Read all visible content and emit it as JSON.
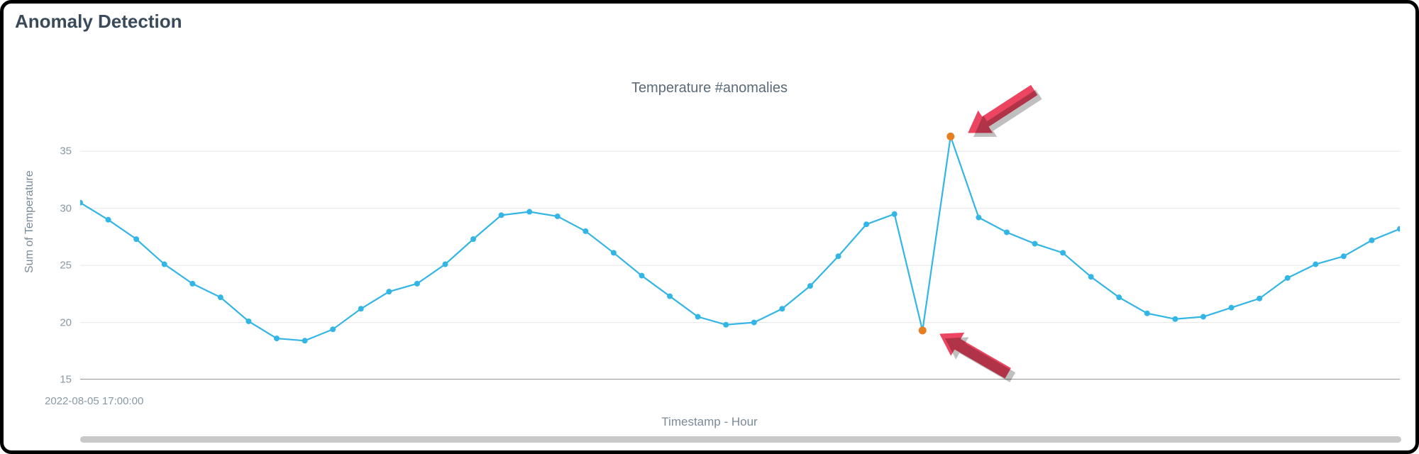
{
  "panel": {
    "title": "Anomaly Detection"
  },
  "chart_data": {
    "type": "line",
    "title": "Temperature #anomalies",
    "xlabel": "Timestamp - Hour",
    "ylabel": "Sum of Temperature",
    "x_first_tick": "2022-08-05 17:00:00",
    "ylim": [
      15,
      38
    ],
    "yticks": [
      15,
      20,
      25,
      30,
      35
    ],
    "grid": true,
    "series": [
      {
        "name": "Temperature",
        "color": "#33b5e5",
        "values": [
          30.5,
          29.0,
          27.3,
          25.1,
          23.4,
          22.2,
          20.1,
          18.6,
          18.4,
          19.4,
          21.2,
          22.7,
          23.4,
          25.1,
          27.3,
          29.4,
          29.7,
          29.3,
          28.0,
          26.1,
          24.1,
          22.3,
          20.5,
          19.8,
          20.0,
          21.2,
          23.2,
          25.8,
          28.6,
          29.5,
          19.3,
          36.3,
          29.2,
          27.9,
          26.9,
          26.1,
          24.0,
          22.2,
          20.8,
          20.3,
          20.5,
          21.3,
          22.1,
          23.9,
          25.1,
          25.8,
          27.2,
          28.2
        ],
        "anomalies": [
          30,
          31
        ],
        "anomaly_color": "#e67e22"
      }
    ],
    "annotations": [
      {
        "type": "arrow",
        "target_index": 31,
        "from": "upper-right",
        "color": "#ec4561"
      },
      {
        "type": "arrow",
        "target_index": 30,
        "from": "lower-right",
        "color": "#ec4561"
      }
    ]
  }
}
